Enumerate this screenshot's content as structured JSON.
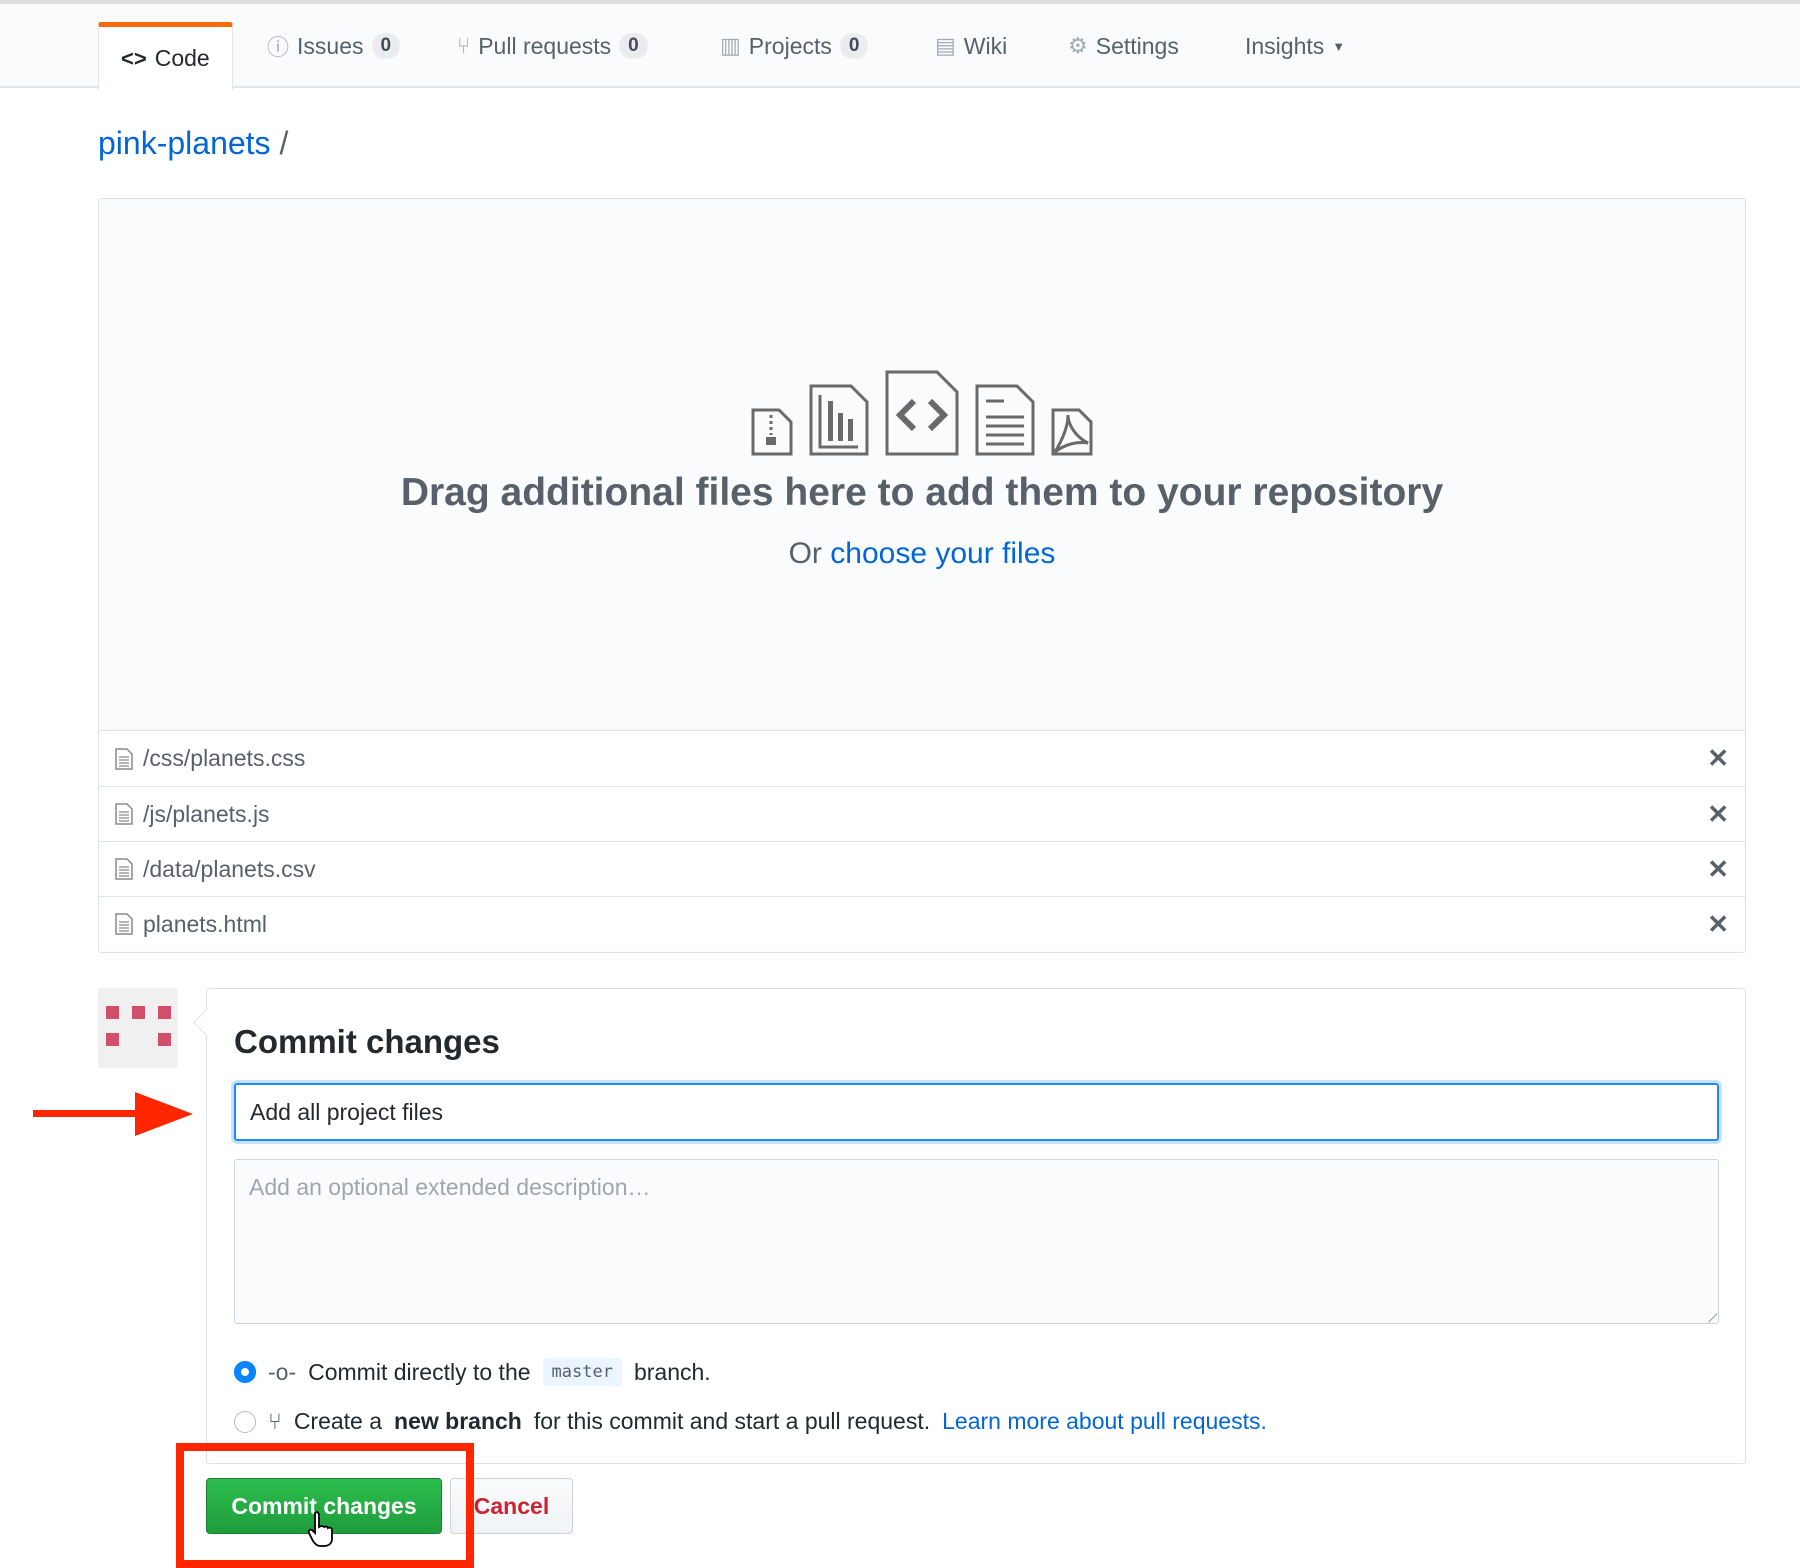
{
  "tabs": [
    {
      "label": "Code",
      "icon": "code-icon"
    },
    {
      "label": "Issues",
      "count": "0",
      "icon": "issue-icon"
    },
    {
      "label": "Pull requests",
      "count": "0",
      "icon": "pull-request-icon"
    },
    {
      "label": "Projects",
      "count": "0",
      "icon": "project-icon"
    },
    {
      "label": "Wiki",
      "icon": "book-icon"
    },
    {
      "label": "Settings",
      "icon": "gear-icon"
    },
    {
      "label": "Insights",
      "icon": "caret-down-icon"
    }
  ],
  "breadcrumb": {
    "repo": "pink-planets",
    "sep": "/"
  },
  "dropzone": {
    "title": "Drag additional files here to add them to your repository",
    "or": "Or",
    "link": "choose your files"
  },
  "files": [
    "/css/planets.css",
    "/js/planets.js",
    "/data/planets.csv",
    "planets.html"
  ],
  "remove_glyph": "✕",
  "commit": {
    "heading": "Commit changes",
    "message": "Add all project files",
    "description_placeholder": "Add an optional extended description…",
    "option1": {
      "pre": "Commit directly to the",
      "branch": "master",
      "post": "branch."
    },
    "option2": {
      "pre": "Create a",
      "bold": "new branch",
      "post": "for this commit and start a pull request.",
      "link": "Learn more about pull requests."
    },
    "submit": "Commit changes",
    "cancel": "Cancel"
  },
  "colors": {
    "accent": "#0366d6",
    "green": "#28a745",
    "annotation": "#ff2600"
  }
}
